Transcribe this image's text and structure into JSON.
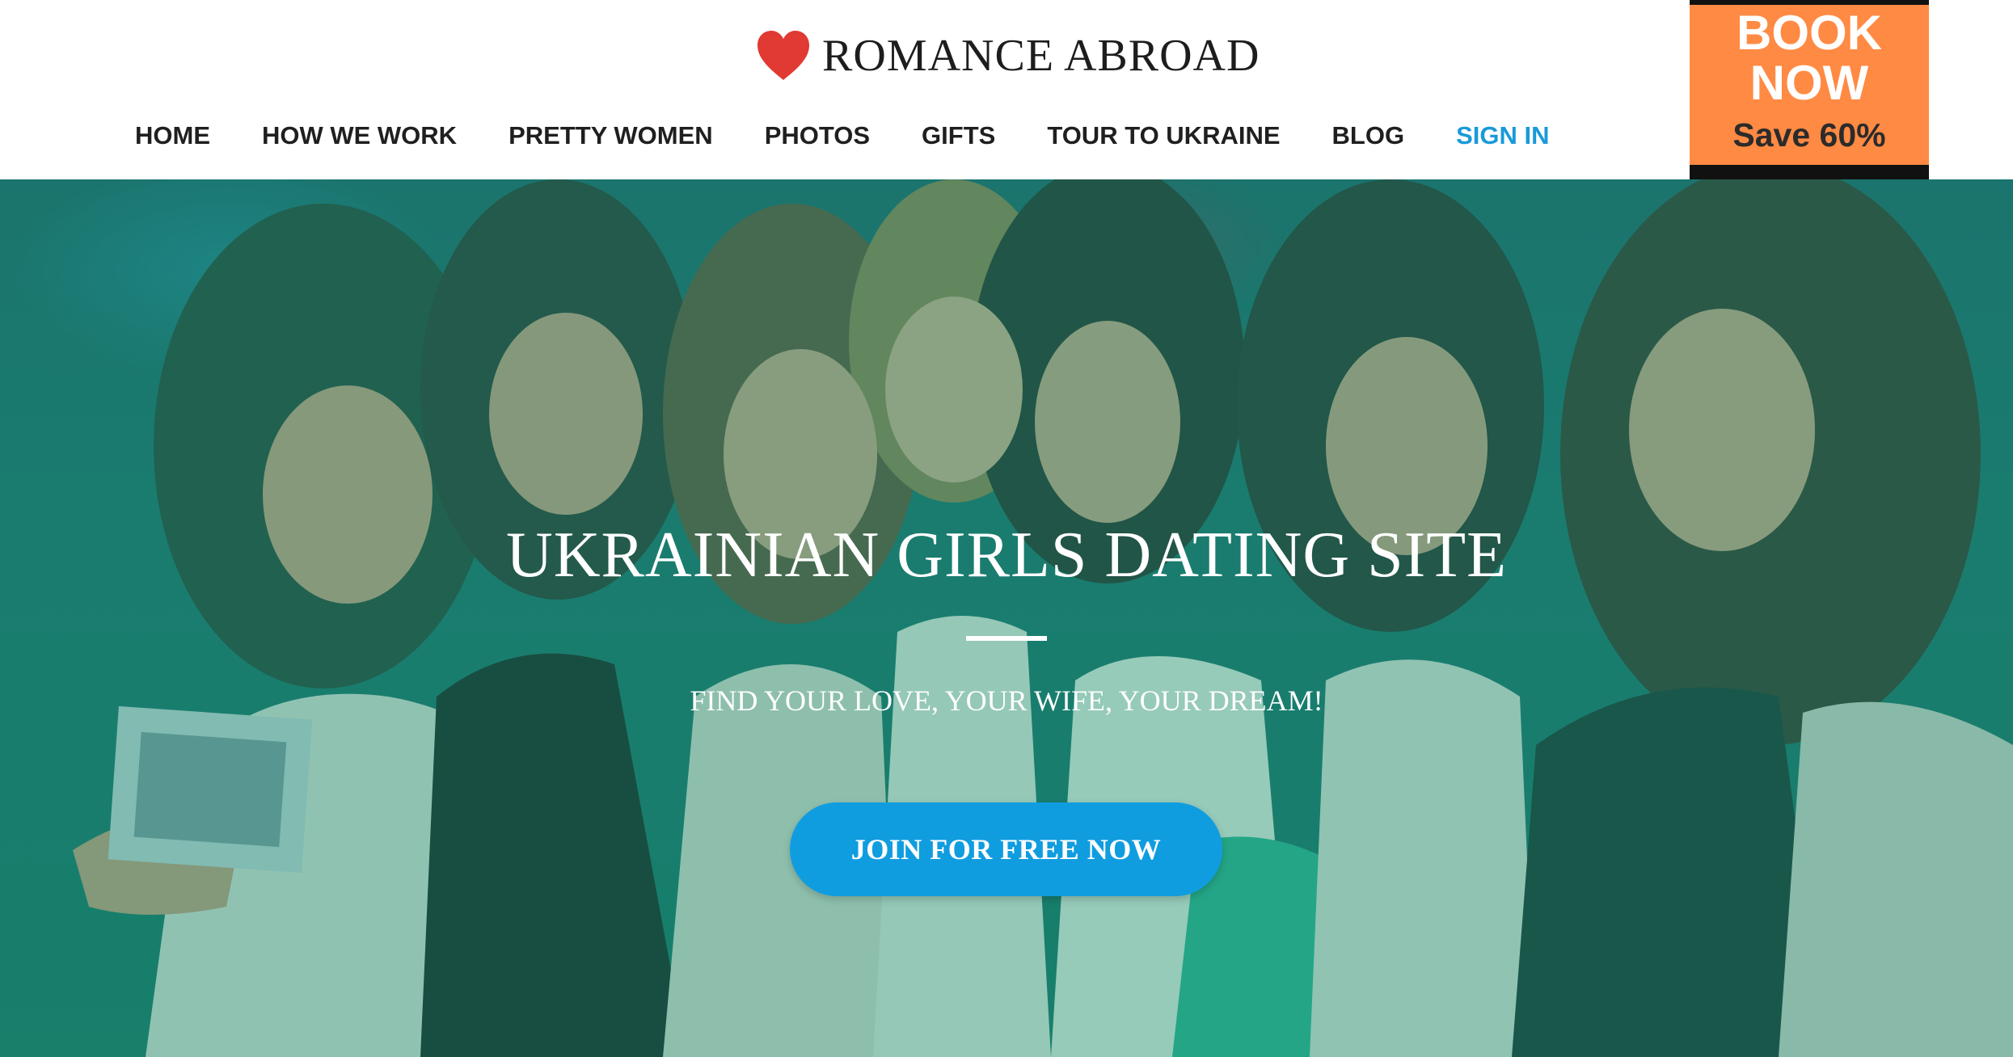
{
  "brand": {
    "name": "ROMANCE ABROAD",
    "logo_icon": "heart-icon",
    "heart_color": "#e03a33"
  },
  "nav": {
    "items": [
      {
        "label": "HOME"
      },
      {
        "label": "HOW WE WORK"
      },
      {
        "label": "PRETTY WOMEN"
      },
      {
        "label": "PHOTOS"
      },
      {
        "label": "GIFTS"
      },
      {
        "label": "TOUR TO UKRAINE"
      },
      {
        "label": "BLOG"
      },
      {
        "label": "SIGN IN"
      }
    ],
    "accent_color": "#1a9ad9"
  },
  "promo": {
    "line1": "BOOK",
    "line2": "NOW",
    "save": "Save 60%",
    "background_color": "#ff8a43"
  },
  "hero": {
    "title": "UKRAINIAN GIRLS DATING SITE",
    "subtitle": "FIND YOUR LOVE, YOUR WIFE, YOUR DREAM!",
    "cta": "JOIN FOR FREE NOW",
    "cta_color": "#109de0",
    "overlay_color": "#169678"
  }
}
